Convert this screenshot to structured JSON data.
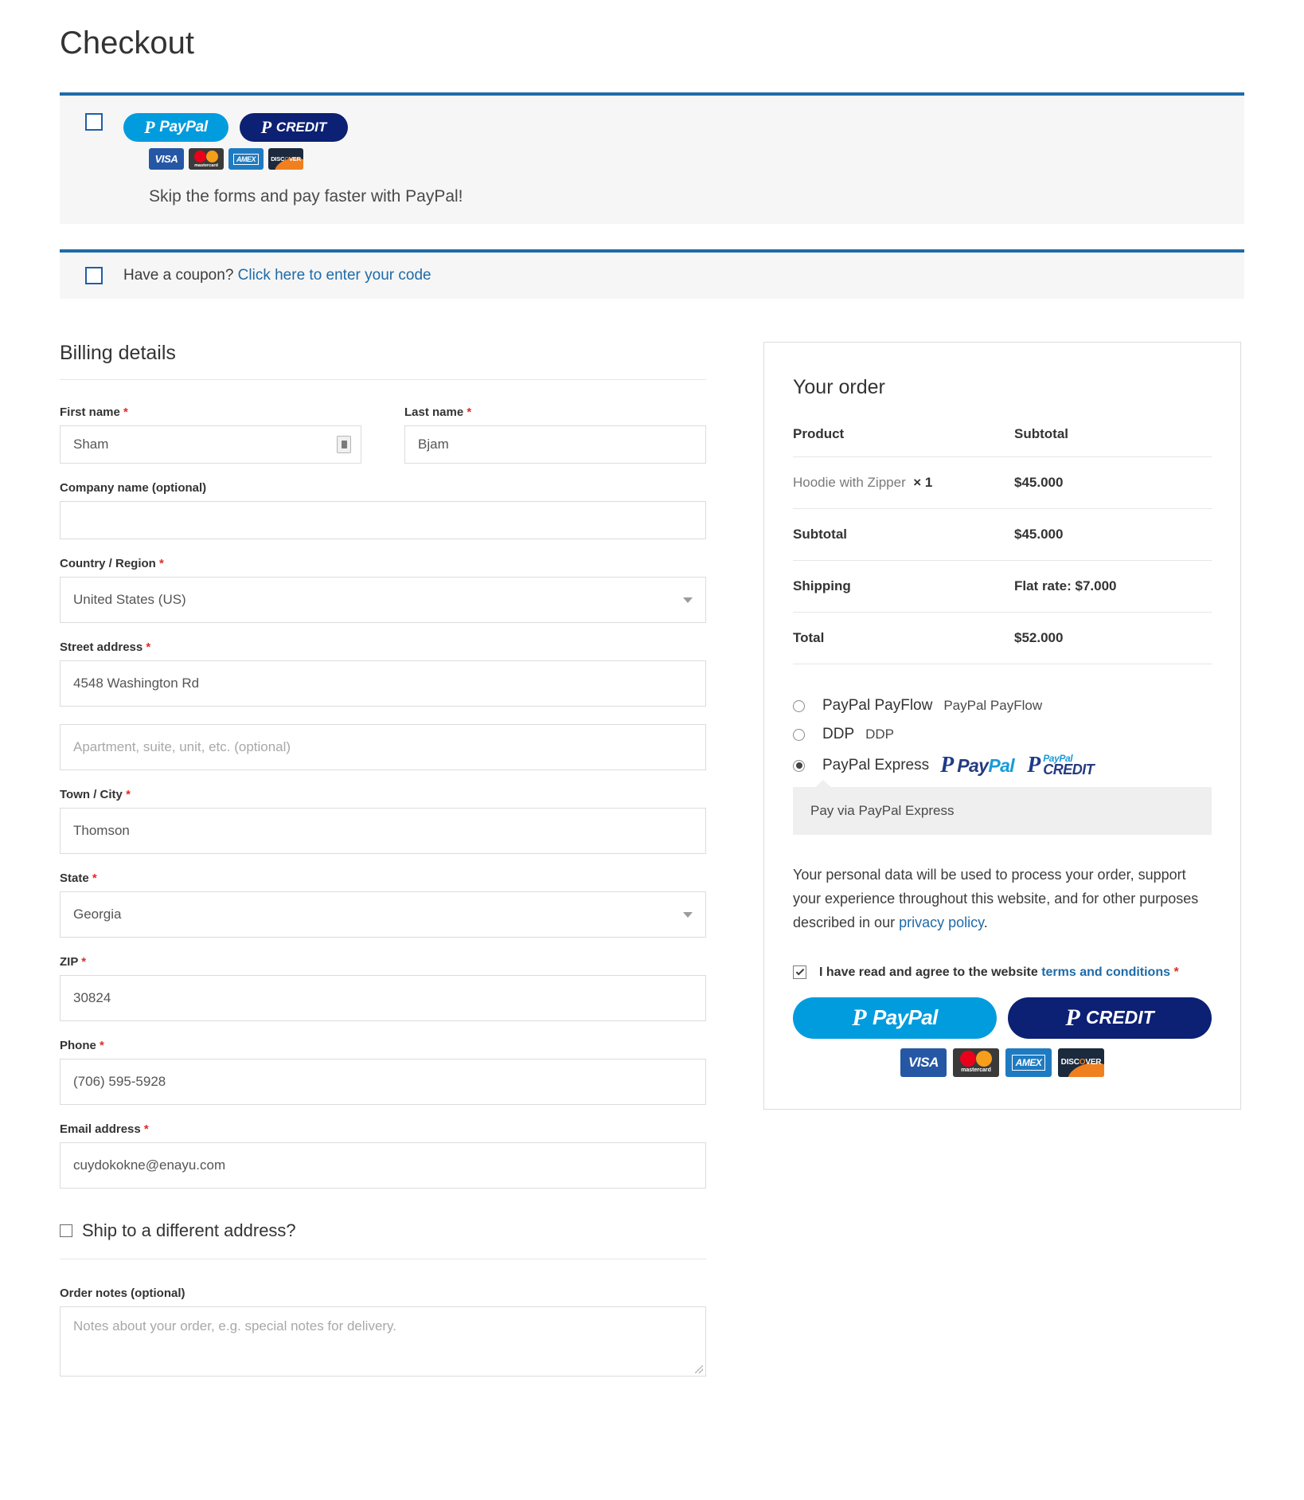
{
  "page": {
    "title": "Checkout"
  },
  "paypal_banner": {
    "checkbox_name": "paypal-express-toggle",
    "buttons": [
      {
        "label": "PayPal",
        "style": "blue"
      },
      {
        "label": "CREDIT",
        "style": "navy"
      }
    ],
    "cards": [
      "VISA",
      "mastercard",
      "AMEX",
      "DISCOVER"
    ],
    "tagline": "Skip the forms and pay faster with PayPal!"
  },
  "coupon": {
    "text": "Have a coupon?",
    "link": "Click here to enter your code"
  },
  "billing": {
    "section_title": "Billing details",
    "fields": {
      "first_name": {
        "label": "First name",
        "required": "*",
        "value": "Sham"
      },
      "last_name": {
        "label": "Last name",
        "required": "*",
        "value": "Bjam"
      },
      "company": {
        "label": "Company name (optional)",
        "value": ""
      },
      "country": {
        "label": "Country / Region",
        "required": "*",
        "value": "United States (US)"
      },
      "street": {
        "label": "Street address",
        "required": "*",
        "value": "4548 Washington Rd"
      },
      "street2": {
        "placeholder": "Apartment, suite, unit, etc. (optional)",
        "value": ""
      },
      "city": {
        "label": "Town / City",
        "required": "*",
        "value": "Thomson"
      },
      "state": {
        "label": "State",
        "required": "*",
        "value": "Georgia"
      },
      "zip": {
        "label": "ZIP",
        "required": "*",
        "value": "30824"
      },
      "phone": {
        "label": "Phone",
        "required": "*",
        "value": "(706) 595-5928"
      },
      "email": {
        "label": "Email address",
        "required": "*",
        "value": "cuydokokne@enayu.com"
      }
    },
    "ship_different": "Ship to a different address?",
    "order_notes": {
      "label": "Order notes (optional)",
      "placeholder": "Notes about your order, e.g. special notes for delivery."
    }
  },
  "order": {
    "title": "Your order",
    "headers": {
      "product": "Product",
      "subtotal": "Subtotal"
    },
    "line_items": [
      {
        "name": "Hoodie with Zipper",
        "qty": "× 1",
        "amount": "$45.000"
      }
    ],
    "rows": [
      {
        "label": "Subtotal",
        "value": "$45.000"
      },
      {
        "label": "Shipping",
        "value": "Flat rate: $7.000"
      },
      {
        "label": "Total",
        "value": "$52.000"
      }
    ],
    "payment_methods": [
      {
        "name": "PayPal PayFlow",
        "alt": "PayPal PayFlow",
        "selected": false,
        "logos": false
      },
      {
        "name": "DDP",
        "alt": "DDP",
        "selected": false,
        "logos": false
      },
      {
        "name": "PayPal Express",
        "alt": "",
        "selected": true,
        "logos": true
      }
    ],
    "payment_description": "Pay via PayPal Express",
    "privacy_text_1": "Your personal data will be used to process your order, support your experience throughout this website, and for other purposes described in our ",
    "privacy_link": "privacy policy",
    "privacy_text_2": ".",
    "terms_text": "I have read and agree to the website ",
    "terms_link": "terms and conditions",
    "terms_required": "*",
    "checkout_buttons": [
      {
        "label": "PayPal",
        "style": "blue"
      },
      {
        "label": "CREDIT",
        "style": "navy"
      }
    ],
    "cards": [
      "VISA",
      "mastercard",
      "AMEX",
      "DISCOVER"
    ],
    "paypal_wordmark": {
      "part_a": "Pay",
      "part_b": "Pal"
    },
    "paypal_credit_wordmark": {
      "top": "PayPal",
      "bottom": "CREDIT"
    }
  },
  "colors": {
    "accent_blue": "#1e6ba8",
    "paypal_blue": "#009cde",
    "paypal_navy": "#0c2074",
    "required_red": "#e02b27"
  }
}
